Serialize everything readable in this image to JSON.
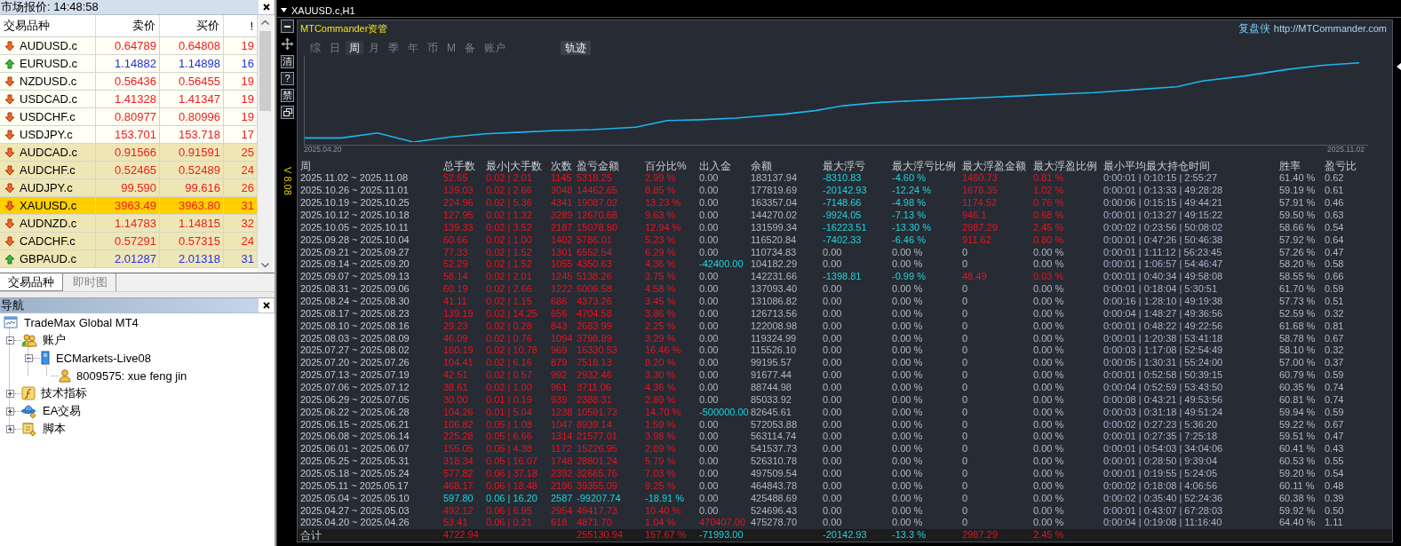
{
  "market_watch": {
    "title": "市场报价: 14:48:58",
    "columns": [
      "交易品种",
      "卖价",
      "买价",
      "!"
    ],
    "rows": [
      {
        "symbol": "AUDUSD.c",
        "bid": "0.64789",
        "ask": "0.64808",
        "spread": "19",
        "rising": false,
        "shaded": false,
        "selected": false
      },
      {
        "symbol": "EURUSD.c",
        "bid": "1.14882",
        "ask": "1.14898",
        "spread": "16",
        "rising": true,
        "shaded": false,
        "selected": false
      },
      {
        "symbol": "NZDUSD.c",
        "bid": "0.56436",
        "ask": "0.56455",
        "spread": "19",
        "rising": false,
        "shaded": false,
        "selected": false
      },
      {
        "symbol": "USDCAD.c",
        "bid": "1.41328",
        "ask": "1.41347",
        "spread": "19",
        "rising": false,
        "shaded": false,
        "selected": false
      },
      {
        "symbol": "USDCHF.c",
        "bid": "0.80977",
        "ask": "0.80996",
        "spread": "19",
        "rising": false,
        "shaded": false,
        "selected": false
      },
      {
        "symbol": "USDJPY.c",
        "bid": "153.701",
        "ask": "153.718",
        "spread": "17",
        "rising": false,
        "shaded": false,
        "selected": false
      },
      {
        "symbol": "AUDCAD.c",
        "bid": "0.91566",
        "ask": "0.91591",
        "spread": "25",
        "rising": false,
        "shaded": true,
        "selected": false
      },
      {
        "symbol": "AUDCHF.c",
        "bid": "0.52465",
        "ask": "0.52489",
        "spread": "24",
        "rising": false,
        "shaded": true,
        "selected": false
      },
      {
        "symbol": "AUDJPY.c",
        "bid": "99.590",
        "ask": "99.616",
        "spread": "26",
        "rising": false,
        "shaded": true,
        "selected": false
      },
      {
        "symbol": "XAUUSD.c",
        "bid": "3963.49",
        "ask": "3963.80",
        "spread": "31",
        "rising": false,
        "shaded": true,
        "selected": true
      },
      {
        "symbol": "AUDNZD.c",
        "bid": "1.14783",
        "ask": "1.14815",
        "spread": "32",
        "rising": false,
        "shaded": true,
        "selected": false
      },
      {
        "symbol": "CADCHF.c",
        "bid": "0.57291",
        "ask": "0.57315",
        "spread": "24",
        "rising": false,
        "shaded": true,
        "selected": false
      },
      {
        "symbol": "GBPAUD.c",
        "bid": "2.01287",
        "ask": "2.01318",
        "spread": "31",
        "rising": true,
        "shaded": true,
        "selected": false
      }
    ],
    "tabs": [
      {
        "label": "交易品种",
        "selected": true
      },
      {
        "label": "即时图",
        "selected": false
      }
    ]
  },
  "navigator": {
    "title": "导航",
    "tree": [
      {
        "label": "TradeMax Global MT4",
        "kind": "terminal",
        "children": [
          {
            "label": "账户",
            "kind": "accounts",
            "expanded": true,
            "children": [
              {
                "label": "ECMarkets-Live08",
                "kind": "server",
                "expanded": true,
                "children": [
                  {
                    "label": "8009575: xue feng jin",
                    "kind": "account"
                  }
                ]
              }
            ]
          },
          {
            "label": "技术指标",
            "kind": "indicators",
            "expanded": false
          },
          {
            "label": "EA交易",
            "kind": "experts",
            "expanded": false
          },
          {
            "label": "脚本",
            "kind": "scripts",
            "expanded": false
          }
        ]
      }
    ]
  },
  "chart_window": {
    "title": "XAUUSD.c,H1",
    "side_tools": [
      {
        "kind": "minimize"
      },
      {
        "kind": "move"
      },
      {
        "kind": "glyph",
        "label": "清"
      },
      {
        "kind": "glyph",
        "label": "?"
      },
      {
        "kind": "glyph",
        "label": "禁"
      },
      {
        "kind": "restore"
      }
    ],
    "version": "V 8.08",
    "commander": {
      "brand": "MTCommander资管",
      "site_name": "复盘侠",
      "site_url": "http://MTCommander.com",
      "tabs": [
        {
          "label": "综",
          "selected": false
        },
        {
          "label": "日",
          "selected": false
        },
        {
          "label": "周",
          "selected": true
        },
        {
          "label": "月",
          "selected": false
        },
        {
          "label": "季",
          "selected": false
        },
        {
          "label": "年",
          "selected": false
        },
        {
          "label": "币",
          "selected": false
        },
        {
          "label": "M",
          "selected": false
        },
        {
          "label": "备",
          "selected": false
        },
        {
          "label": "账户",
          "selected": false
        }
      ],
      "track": {
        "label": "轨迹",
        "on": true
      },
      "chart": {
        "start_label": "2025.04.20",
        "end_label": "2025.11.02"
      },
      "table": {
        "columns": [
          "周",
          "总手数",
          "最小|大手数",
          "次数",
          "盈亏金额",
          "百分比%",
          "出入金",
          "余额",
          "最大浮亏",
          "最大浮亏比例",
          "最大浮盈金额",
          "最大浮盈比例",
          "最小平均最大持仓时间",
          "胜率",
          "盈亏比"
        ],
        "rows": [
          {
            "cells": [
              "2025.11.02 ~ 2025.11.08",
              "52.65",
              "0.02 | 2.01",
              "1145",
              "5318.25",
              "2.99 %",
              "0.00",
              "183137.94",
              "-8310.83",
              "-4.60 %",
              "1460.73",
              "0.81 %",
              "0:00:01 | 0:10:15 | 2:55:27",
              "61.40 %",
              "0.62"
            ],
            "loss": false,
            "deposit": false,
            "withdrawal": false,
            "float_loss": true,
            "float_profit": true
          },
          {
            "cells": [
              "2025.10.26 ~ 2025.11.01",
              "139.03",
              "0.02 | 2.66",
              "3048",
              "14462.65",
              "8.85 %",
              "0.00",
              "177819.69",
              "-20142.93",
              "-12.24 %",
              "1678.35",
              "1.02 %",
              "0:00:01 | 0:13:33 | 49:28:28",
              "59.19 %",
              "0.61"
            ],
            "loss": false,
            "deposit": false,
            "withdrawal": false,
            "float_loss": true,
            "float_profit": true
          },
          {
            "cells": [
              "2025.10.19 ~ 2025.10.25",
              "224.96",
              "0.02 | 5.36",
              "4341",
              "19087.02",
              "13.23 %",
              "0.00",
              "163357.04",
              "-7148.66",
              "-4.98 %",
              "1174.52",
              "0.76 %",
              "0:00:06 | 0:15:15 | 49:44:21",
              "57.91 %",
              "0.46"
            ],
            "loss": false,
            "deposit": false,
            "withdrawal": false,
            "float_loss": true,
            "float_profit": true
          },
          {
            "cells": [
              "2025.10.12 ~ 2025.10.18",
              "127.95",
              "0.02 | 1.32",
              "3289",
              "12670.68",
              "9.63 %",
              "0.00",
              "144270.02",
              "-9924.05",
              "-7.13 %",
              "946.1",
              "0.68 %",
              "0:00:01 | 0:13:27 | 49:15:22",
              "59.50 %",
              "0.63"
            ],
            "loss": false,
            "deposit": false,
            "withdrawal": false,
            "float_loss": true,
            "float_profit": true
          },
          {
            "cells": [
              "2025.10.05 ~ 2025.10.11",
              "139.33",
              "0.02 | 3.52",
              "2187",
              "15078.50",
              "12.94 %",
              "0.00",
              "131599.34",
              "-16223.51",
              "-13.30 %",
              "2987.29",
              "2.45 %",
              "0:00:02 | 0:23:56 | 50:08:02",
              "58.66 %",
              "0.54"
            ],
            "loss": false,
            "deposit": false,
            "withdrawal": false,
            "float_loss": true,
            "float_profit": true
          },
          {
            "cells": [
              "2025.09.28 ~ 2025.10.04",
              "60.66",
              "0.02 | 1.00",
              "1402",
              "5786.01",
              "5.23 %",
              "0.00",
              "116520.84",
              "-7402.33",
              "-6.46 %",
              "911.62",
              "0.80 %",
              "0:00:01 | 0:47:26 | 50:46:38",
              "57.92 %",
              "0.64"
            ],
            "loss": false,
            "deposit": false,
            "withdrawal": false,
            "float_loss": true,
            "float_profit": true
          },
          {
            "cells": [
              "2025.09.21 ~ 2025.09.27",
              "77.33",
              "0.02 | 1.52",
              "1301",
              "6552.54",
              "6.29 %",
              "0.00",
              "110734.83",
              "0.00",
              "0.00 %",
              "0",
              "0.00 %",
              "0:00:01 | 1:11:12 | 56:23:45",
              "57.26 %",
              "0.47"
            ],
            "loss": false,
            "deposit": false,
            "withdrawal": false,
            "float_loss": false,
            "float_profit": false
          },
          {
            "cells": [
              "2025.09.14 ~ 2025.09.20",
              "52.29",
              "0.02 | 1.52",
              "1055",
              "4350.63",
              "4.36 %",
              "-42400.00",
              "104182.29",
              "0.00",
              "0.00 %",
              "0",
              "0.00 %",
              "0:00:01 | 1:06:57 | 54:46:47",
              "58.20 %",
              "0.58"
            ],
            "loss": false,
            "deposit": false,
            "withdrawal": true,
            "float_loss": false,
            "float_profit": false
          },
          {
            "cells": [
              "2025.09.07 ~ 2025.09.13",
              "58.14",
              "0.02 | 2.01",
              "1245",
              "5138.26",
              "3.75 %",
              "0.00",
              "142231.66",
              "-1398.81",
              "-0.99 %",
              "48.49",
              "0.03 %",
              "0:00:01 | 0:40:34 | 49:58:08",
              "58.55 %",
              "0.66"
            ],
            "loss": false,
            "deposit": false,
            "withdrawal": false,
            "float_loss": true,
            "float_profit": true
          },
          {
            "cells": [
              "2025.08.31 ~ 2025.09.06",
              "60.19",
              "0.02 | 2.66",
              "1222",
              "6006.58",
              "4.58 %",
              "0.00",
              "137093.40",
              "0.00",
              "0.00 %",
              "0",
              "0.00 %",
              "0:00:01 | 0:18:04 | 5:30:51",
              "61.70 %",
              "0.59"
            ],
            "loss": false,
            "deposit": false,
            "withdrawal": false,
            "float_loss": false,
            "float_profit": false
          },
          {
            "cells": [
              "2025.08.24 ~ 2025.08.30",
              "41.11",
              "0.02 | 1.15",
              "686",
              "4373.26",
              "3.45 %",
              "0.00",
              "131086.82",
              "0.00",
              "0.00 %",
              "0",
              "0.00 %",
              "0:00:16 | 1:28:10 | 49:19:38",
              "57.73 %",
              "0.51"
            ],
            "loss": false,
            "deposit": false,
            "withdrawal": false,
            "float_loss": false,
            "float_profit": false
          },
          {
            "cells": [
              "2025.08.17 ~ 2025.08.23",
              "139.19",
              "0.02 | 14.25",
              "656",
              "4704.58",
              "3.86 %",
              "0.00",
              "126713.56",
              "0.00",
              "0.00 %",
              "0",
              "0.00 %",
              "0:00:04 | 1:48:27 | 49:36:56",
              "52.59 %",
              "0.32"
            ],
            "loss": false,
            "deposit": false,
            "withdrawal": false,
            "float_loss": false,
            "float_profit": false
          },
          {
            "cells": [
              "2025.08.10 ~ 2025.08.16",
              "29.23",
              "0.02 | 0.28",
              "843",
              "2683.99",
              "2.25 %",
              "0.00",
              "122008.98",
              "0.00",
              "0.00 %",
              "0",
              "0.00 %",
              "0:00:01 | 0:48:22 | 49:22:56",
              "61.68 %",
              "0.81"
            ],
            "loss": false,
            "deposit": false,
            "withdrawal": false,
            "float_loss": false,
            "float_profit": false
          },
          {
            "cells": [
              "2025.08.03 ~ 2025.08.09",
              "46.09",
              "0.02 | 0.76",
              "1094",
              "3798.89",
              "3.29 %",
              "0.00",
              "119324.99",
              "0.00",
              "0.00 %",
              "0",
              "0.00 %",
              "0:00:01 | 1:20:38 | 53:41:18",
              "58.78 %",
              "0.67"
            ],
            "loss": false,
            "deposit": false,
            "withdrawal": false,
            "float_loss": false,
            "float_profit": false
          },
          {
            "cells": [
              "2025.07.27 ~ 2025.08.02",
              "160.19",
              "0.02 | 10.78",
              "969",
              "16330.53",
              "16.46 %",
              "0.00",
              "115526.10",
              "0.00",
              "0.00 %",
              "0",
              "0.00 %",
              "0:00:03 | 1:17:08 | 52:54:49",
              "58.10 %",
              "0.32"
            ],
            "loss": false,
            "deposit": false,
            "withdrawal": false,
            "float_loss": false,
            "float_profit": false
          },
          {
            "cells": [
              "2025.07.20 ~ 2025.07.26",
              "104.41",
              "0.02 | 6.16",
              "879",
              "7518.13",
              "8.20 %",
              "0.00",
              "99195.57",
              "0.00",
              "0.00 %",
              "0",
              "0.00 %",
              "0:00:05 | 1:30:31 | 55:24:00",
              "57.00 %",
              "0.37"
            ],
            "loss": false,
            "deposit": false,
            "withdrawal": false,
            "float_loss": false,
            "float_profit": false
          },
          {
            "cells": [
              "2025.07.13 ~ 2025.07.19",
              "42.51",
              "0.02 | 0.57",
              "992",
              "2932.46",
              "3.30 %",
              "0.00",
              "91677.44",
              "0.00",
              "0.00 %",
              "0",
              "0.00 %",
              "0:00:01 | 0:52:58 | 50:39:15",
              "60.79 %",
              "0.59"
            ],
            "loss": false,
            "deposit": false,
            "withdrawal": false,
            "float_loss": false,
            "float_profit": false
          },
          {
            "cells": [
              "2025.07.06 ~ 2025.07.12",
              "38.61",
              "0.02 | 1.00",
              "961",
              "3711.06",
              "4.36 %",
              "0.00",
              "88744.98",
              "0.00",
              "0.00 %",
              "0",
              "0.00 %",
              "0:00:04 | 0:52:59 | 53:43:50",
              "60.35 %",
              "0.74"
            ],
            "loss": false,
            "deposit": false,
            "withdrawal": false,
            "float_loss": false,
            "float_profit": false
          },
          {
            "cells": [
              "2025.06.29 ~ 2025.07.05",
              "30.00",
              "0.01 | 0.19",
              "939",
              "2388.31",
              "2.89 %",
              "0.00",
              "85033.92",
              "0.00",
              "0.00 %",
              "0",
              "0.00 %",
              "0:00:08 | 0:43:21 | 49:53:56",
              "60.81 %",
              "0.74"
            ],
            "loss": false,
            "deposit": false,
            "withdrawal": false,
            "float_loss": false,
            "float_profit": false
          },
          {
            "cells": [
              "2025.06.22 ~ 2025.06.28",
              "104.26",
              "0.01 | 5.04",
              "1238",
              "10591.73",
              "14.70 %",
              "-500000.00",
              "82645.61",
              "0.00",
              "0.00 %",
              "0",
              "0.00 %",
              "0:00:03 | 0:31:18 | 49:51:24",
              "59.94 %",
              "0.59"
            ],
            "loss": false,
            "deposit": false,
            "withdrawal": true,
            "float_loss": false,
            "float_profit": false
          },
          {
            "cells": [
              "2025.06.15 ~ 2025.06.21",
              "106.82",
              "0.05 | 1.08",
              "1047",
              "8939.14",
              "1.59 %",
              "0.00",
              "572053.88",
              "0.00",
              "0.00 %",
              "0",
              "0.00 %",
              "0:00:02 | 0:27:23 | 5:36:20",
              "59.22 %",
              "0.67"
            ],
            "loss": false,
            "deposit": false,
            "withdrawal": false,
            "float_loss": false,
            "float_profit": false
          },
          {
            "cells": [
              "2025.06.08 ~ 2025.06.14",
              "225.28",
              "0.05 | 6.66",
              "1314",
              "21577.01",
              "3.98 %",
              "0.00",
              "563114.74",
              "0.00",
              "0.00 %",
              "0",
              "0.00 %",
              "0:00:01 | 0:27:35 | 7:25:18",
              "59.51 %",
              "0.47"
            ],
            "loss": false,
            "deposit": false,
            "withdrawal": false,
            "float_loss": false,
            "float_profit": false
          },
          {
            "cells": [
              "2025.06.01 ~ 2025.06.07",
              "155.05",
              "0.05 | 4.38",
              "1172",
              "15226.95",
              "2.89 %",
              "0.00",
              "541537.73",
              "0.00",
              "0.00 %",
              "0",
              "0.00 %",
              "0:00:01 | 0:54:03 | 34:04:06",
              "60.41 %",
              "0.43"
            ],
            "loss": false,
            "deposit": false,
            "withdrawal": false,
            "float_loss": false,
            "float_profit": false
          },
          {
            "cells": [
              "2025.05.25 ~ 2025.05.31",
              "318.34",
              "0.05 | 16.07",
              "1748",
              "28801.24",
              "5.79 %",
              "0.00",
              "526310.78",
              "0.00",
              "0.00 %",
              "0",
              "0.00 %",
              "0:00:01 | 0:28:50 | 9:39:04",
              "60.53 %",
              "0.55"
            ],
            "loss": false,
            "deposit": false,
            "withdrawal": false,
            "float_loss": false,
            "float_profit": false
          },
          {
            "cells": [
              "2025.05.18 ~ 2025.05.24",
              "577.82",
              "0.06 | 37.18",
              "2392",
              "32665.76",
              "7.03 %",
              "0.00",
              "497509.54",
              "0.00",
              "0.00 %",
              "0",
              "0.00 %",
              "0:00:01 | 0:19:55 | 5:24:05",
              "59.20 %",
              "0.54"
            ],
            "loss": false,
            "deposit": false,
            "withdrawal": false,
            "float_loss": false,
            "float_profit": false
          },
          {
            "cells": [
              "2025.05.11 ~ 2025.05.17",
              "468.17",
              "0.06 | 18.48",
              "2196",
              "39355.09",
              "9.25 %",
              "0.00",
              "464843.78",
              "0.00",
              "0.00 %",
              "0",
              "0.00 %",
              "0:00:02 | 0:18:08 | 4:06:56",
              "60.11 %",
              "0.48"
            ],
            "loss": false,
            "deposit": false,
            "withdrawal": false,
            "float_loss": false,
            "float_profit": false
          },
          {
            "cells": [
              "2025.05.04 ~ 2025.05.10",
              "597.80",
              "0.06 | 16.20",
              "2587",
              "-99207.74",
              "-18.91 %",
              "0.00",
              "425488.69",
              "0.00",
              "0.00 %",
              "0",
              "0.00 %",
              "0:00:02 | 0:35:40 | 52:24:36",
              "60.38 %",
              "0.39"
            ],
            "loss": true,
            "deposit": false,
            "withdrawal": false,
            "float_loss": false,
            "float_profit": false
          },
          {
            "cells": [
              "2025.04.27 ~ 2025.05.03",
              "492.12",
              "0.06 | 6.95",
              "2954",
              "49417.73",
              "10.40 %",
              "0.00",
              "524696.43",
              "0.00",
              "0.00 %",
              "0",
              "0.00 %",
              "0:00:01 | 0:43:07 | 67:28:03",
              "59.92 %",
              "0.50"
            ],
            "loss": false,
            "deposit": false,
            "withdrawal": false,
            "float_loss": false,
            "float_profit": false
          },
          {
            "cells": [
              "2025.04.20 ~ 2025.04.26",
              "53.41",
              "0.06 | 0.21",
              "618",
              "4871.70",
              "1.04 %",
              "470407.00",
              "475278.70",
              "0.00",
              "0.00 %",
              "0",
              "0.00 %",
              "0:00:04 | 0:19:08 | 11:16:40",
              "64.40 %",
              "1.11"
            ],
            "loss": false,
            "deposit": true,
            "withdrawal": false,
            "float_loss": false,
            "float_profit": false
          }
        ],
        "total": {
          "label": "合计",
          "lots": "4722.94",
          "amount": "255130.94",
          "percent": "157.67 %",
          "cash_amount": "-71993.00",
          "max_float_loss": "-20142.93",
          "max_float_loss_ratio": "-13.3 %",
          "max_float_profit": "2987.29",
          "max_float_profit_ratio": "2.45 %",
          "loss": false,
          "deposit": false,
          "withdrawal": true,
          "float_loss": true,
          "float_profit": true
        }
      }
    }
  }
}
